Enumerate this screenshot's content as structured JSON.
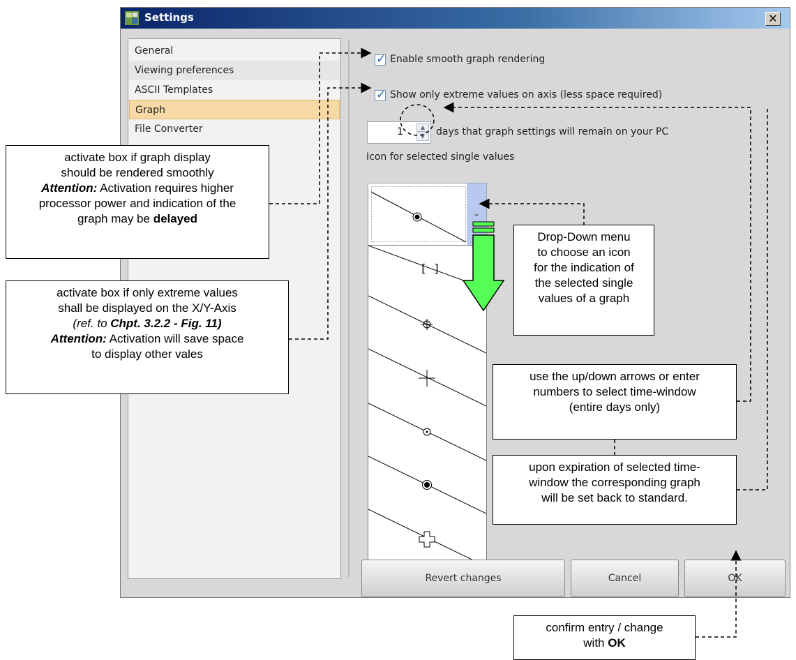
{
  "window": {
    "title": "Settings",
    "close_label": "✕"
  },
  "sidebar": {
    "items": [
      {
        "label": "General"
      },
      {
        "label": "Viewing preferences"
      },
      {
        "label": "ASCII Templates"
      },
      {
        "label": "Graph"
      },
      {
        "label": "File Converter"
      }
    ],
    "selected": "Graph"
  },
  "graph_settings": {
    "smooth_label": "Enable smooth graph rendering",
    "smooth_checked": true,
    "extreme_label": "Show only extreme values on axis (less space required)",
    "extreme_checked": true,
    "days_value": "1",
    "days_label": "days that graph settings will remain on your PC",
    "icon_label": "Icon for selected single values",
    "icon_options": [
      "[ ]",
      "crosshair-circle",
      "plus",
      "dot-circle",
      "filled-circle",
      "outline-plus"
    ]
  },
  "buttons": {
    "revert": "Revert changes",
    "cancel": "Cancel",
    "ok": "OK"
  },
  "callouts": {
    "smooth": {
      "line1": "activate box if graph display",
      "line2": "should be rendered  smoothly",
      "line3_b": "Attention:",
      "line3": " Activation requires higher",
      "line4": "processor power and indication of the",
      "line5": "graph may be ",
      "line5_b": "delayed"
    },
    "extreme": {
      "line1": "activate box if only extreme values",
      "line2": "shall be displayed on the X/Y-Axis",
      "line3_i": "(ref. to ",
      "line3_b": "Chpt. 3.2.2 - Fig. 11)",
      "line4_b": "Attention:",
      "line4": " Activation will save space",
      "line5": "to display other vales"
    },
    "dropdown": {
      "lines": [
        "Drop-Down menu",
        "to choose an icon",
        "for the indication of",
        "the selected single",
        "values of a graph"
      ]
    },
    "arrows": {
      "lines": [
        "use the up/down arrows or enter",
        "numbers to select time-window",
        "(entire days only)"
      ]
    },
    "expire": {
      "lines": [
        "upon expiration of selected time-",
        "window the corresponding graph",
        "will be set back to standard."
      ]
    },
    "ok": {
      "line1": "confirm entry / change",
      "line2": "with ",
      "line2_b": "OK"
    }
  },
  "colors": {
    "accent_arrow": "#55ff55",
    "selection": "#f7d9a6",
    "titlebar": "#0a246a"
  }
}
